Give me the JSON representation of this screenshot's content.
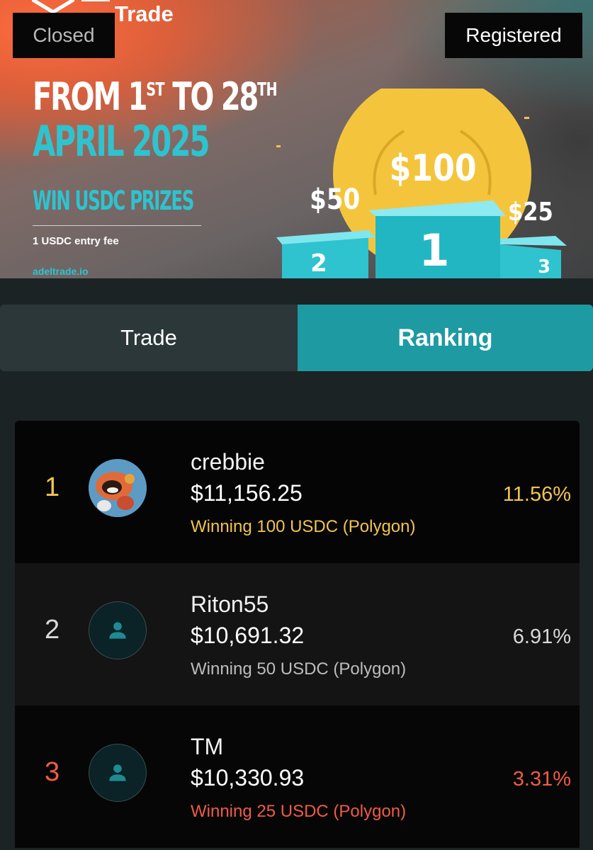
{
  "banner": {
    "brand": "Trade",
    "status_closed": "Closed",
    "status_registered": "Registered",
    "date_from_prefix": "FROM 1",
    "date_from_suffix": "ST",
    "date_to_prefix": " TO 28",
    "date_to_suffix": "TH",
    "date_month": "APRIL 2025",
    "headline": "WIN USDC PRIZES",
    "entry_fee": "1 USDC entry fee",
    "website": "adeltrade.io",
    "prizes": {
      "first": "$100",
      "second": "$50",
      "third": "$25"
    },
    "podium_labels": {
      "first": "1",
      "second": "2",
      "third": "3"
    }
  },
  "tabs": [
    {
      "label": "Trade",
      "active": false
    },
    {
      "label": "Ranking",
      "active": true
    }
  ],
  "ranking": [
    {
      "rank": "1",
      "username": "crebbie",
      "amount": "$11,156.25",
      "winning": "Winning 100 USDC (Polygon)",
      "percent": "11.56%",
      "avatar": "custom-avatar"
    },
    {
      "rank": "2",
      "username": "Riton55",
      "amount": "$10,691.32",
      "winning": "Winning 50 USDC (Polygon)",
      "percent": "6.91%",
      "avatar": "user-icon"
    },
    {
      "rank": "3",
      "username": "TM",
      "amount": "$10,330.93",
      "winning": "Winning 25 USDC (Polygon)",
      "percent": "3.31%",
      "avatar": "user-icon"
    }
  ],
  "colors": {
    "accent_teal": "#1e9aa2",
    "gold": "#f1c451",
    "bronze_red": "#f05b45"
  }
}
